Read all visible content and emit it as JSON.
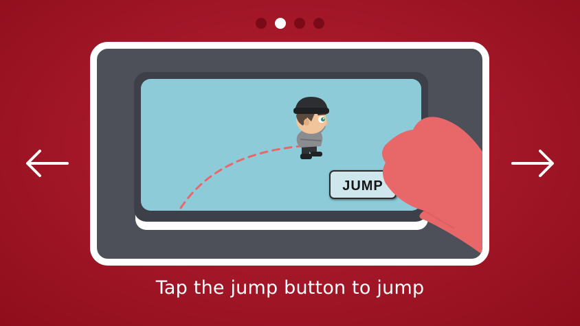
{
  "pagination": {
    "total": 4,
    "active_index": 1
  },
  "nav": {
    "prev_icon": "arrow-left-icon",
    "next_icon": "arrow-right-icon"
  },
  "game": {
    "jump_button_label": "JUMP"
  },
  "caption": "Tap the jump button to jump",
  "colors": {
    "background": "#a5182a",
    "frame_border": "#ffffff",
    "frame_fill": "#4d5059",
    "sky": "#8ecbd9",
    "phone_body": "#3d4048",
    "hand": "#e8686a",
    "trajectory": "#e8686a",
    "dot_inactive": "#7a0b16",
    "dot_active": "#ffffff"
  }
}
